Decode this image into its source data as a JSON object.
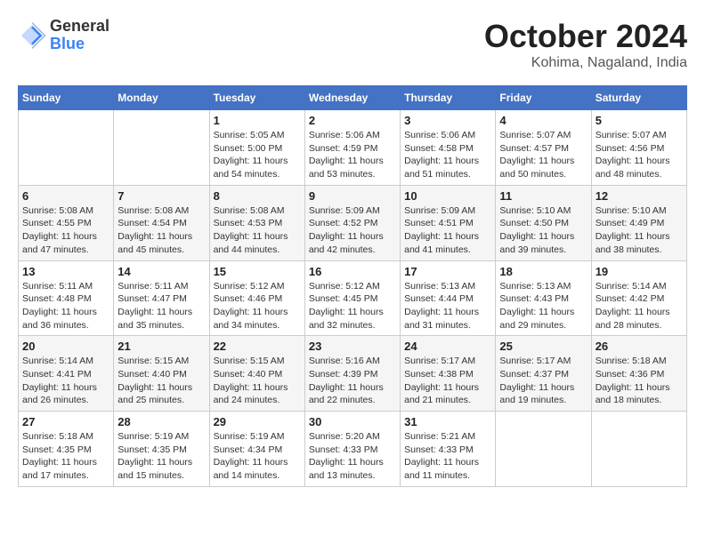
{
  "logo": {
    "general": "General",
    "blue": "Blue"
  },
  "header": {
    "month": "October 2024",
    "location": "Kohima, Nagaland, India"
  },
  "weekdays": [
    "Sunday",
    "Monday",
    "Tuesday",
    "Wednesday",
    "Thursday",
    "Friday",
    "Saturday"
  ],
  "weeks": [
    [
      {
        "day": "",
        "info": ""
      },
      {
        "day": "",
        "info": ""
      },
      {
        "day": "1",
        "info": "Sunrise: 5:05 AM\nSunset: 5:00 PM\nDaylight: 11 hours and 54 minutes."
      },
      {
        "day": "2",
        "info": "Sunrise: 5:06 AM\nSunset: 4:59 PM\nDaylight: 11 hours and 53 minutes."
      },
      {
        "day": "3",
        "info": "Sunrise: 5:06 AM\nSunset: 4:58 PM\nDaylight: 11 hours and 51 minutes."
      },
      {
        "day": "4",
        "info": "Sunrise: 5:07 AM\nSunset: 4:57 PM\nDaylight: 11 hours and 50 minutes."
      },
      {
        "day": "5",
        "info": "Sunrise: 5:07 AM\nSunset: 4:56 PM\nDaylight: 11 hours and 48 minutes."
      }
    ],
    [
      {
        "day": "6",
        "info": "Sunrise: 5:08 AM\nSunset: 4:55 PM\nDaylight: 11 hours and 47 minutes."
      },
      {
        "day": "7",
        "info": "Sunrise: 5:08 AM\nSunset: 4:54 PM\nDaylight: 11 hours and 45 minutes."
      },
      {
        "day": "8",
        "info": "Sunrise: 5:08 AM\nSunset: 4:53 PM\nDaylight: 11 hours and 44 minutes."
      },
      {
        "day": "9",
        "info": "Sunrise: 5:09 AM\nSunset: 4:52 PM\nDaylight: 11 hours and 42 minutes."
      },
      {
        "day": "10",
        "info": "Sunrise: 5:09 AM\nSunset: 4:51 PM\nDaylight: 11 hours and 41 minutes."
      },
      {
        "day": "11",
        "info": "Sunrise: 5:10 AM\nSunset: 4:50 PM\nDaylight: 11 hours and 39 minutes."
      },
      {
        "day": "12",
        "info": "Sunrise: 5:10 AM\nSunset: 4:49 PM\nDaylight: 11 hours and 38 minutes."
      }
    ],
    [
      {
        "day": "13",
        "info": "Sunrise: 5:11 AM\nSunset: 4:48 PM\nDaylight: 11 hours and 36 minutes."
      },
      {
        "day": "14",
        "info": "Sunrise: 5:11 AM\nSunset: 4:47 PM\nDaylight: 11 hours and 35 minutes."
      },
      {
        "day": "15",
        "info": "Sunrise: 5:12 AM\nSunset: 4:46 PM\nDaylight: 11 hours and 34 minutes."
      },
      {
        "day": "16",
        "info": "Sunrise: 5:12 AM\nSunset: 4:45 PM\nDaylight: 11 hours and 32 minutes."
      },
      {
        "day": "17",
        "info": "Sunrise: 5:13 AM\nSunset: 4:44 PM\nDaylight: 11 hours and 31 minutes."
      },
      {
        "day": "18",
        "info": "Sunrise: 5:13 AM\nSunset: 4:43 PM\nDaylight: 11 hours and 29 minutes."
      },
      {
        "day": "19",
        "info": "Sunrise: 5:14 AM\nSunset: 4:42 PM\nDaylight: 11 hours and 28 minutes."
      }
    ],
    [
      {
        "day": "20",
        "info": "Sunrise: 5:14 AM\nSunset: 4:41 PM\nDaylight: 11 hours and 26 minutes."
      },
      {
        "day": "21",
        "info": "Sunrise: 5:15 AM\nSunset: 4:40 PM\nDaylight: 11 hours and 25 minutes."
      },
      {
        "day": "22",
        "info": "Sunrise: 5:15 AM\nSunset: 4:40 PM\nDaylight: 11 hours and 24 minutes."
      },
      {
        "day": "23",
        "info": "Sunrise: 5:16 AM\nSunset: 4:39 PM\nDaylight: 11 hours and 22 minutes."
      },
      {
        "day": "24",
        "info": "Sunrise: 5:17 AM\nSunset: 4:38 PM\nDaylight: 11 hours and 21 minutes."
      },
      {
        "day": "25",
        "info": "Sunrise: 5:17 AM\nSunset: 4:37 PM\nDaylight: 11 hours and 19 minutes."
      },
      {
        "day": "26",
        "info": "Sunrise: 5:18 AM\nSunset: 4:36 PM\nDaylight: 11 hours and 18 minutes."
      }
    ],
    [
      {
        "day": "27",
        "info": "Sunrise: 5:18 AM\nSunset: 4:35 PM\nDaylight: 11 hours and 17 minutes."
      },
      {
        "day": "28",
        "info": "Sunrise: 5:19 AM\nSunset: 4:35 PM\nDaylight: 11 hours and 15 minutes."
      },
      {
        "day": "29",
        "info": "Sunrise: 5:19 AM\nSunset: 4:34 PM\nDaylight: 11 hours and 14 minutes."
      },
      {
        "day": "30",
        "info": "Sunrise: 5:20 AM\nSunset: 4:33 PM\nDaylight: 11 hours and 13 minutes."
      },
      {
        "day": "31",
        "info": "Sunrise: 5:21 AM\nSunset: 4:33 PM\nDaylight: 11 hours and 11 minutes."
      },
      {
        "day": "",
        "info": ""
      },
      {
        "day": "",
        "info": ""
      }
    ]
  ]
}
